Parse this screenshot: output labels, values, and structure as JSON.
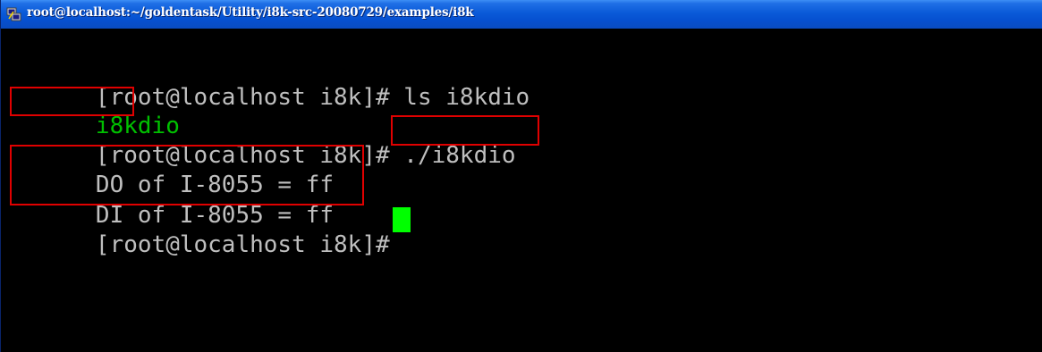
{
  "window": {
    "title": "root@localhost:~/goldentask/Utility/i8k-src-20080729/examples/i8k",
    "icon": "putty-terminal-icon"
  },
  "terminal": {
    "lines": [
      {
        "prompt": "[root@localhost i8k]# ",
        "text": "ls i8kdio"
      },
      {
        "text": "i8kdio"
      },
      {
        "prompt": "[root@localhost i8k]# ",
        "text": "./i8kdio"
      },
      {
        "text": "DO of I-8055 = ff"
      },
      {
        "text": "DI of I-8055 = ff"
      },
      {
        "prompt": "[root@localhost i8k]# ",
        "text": ""
      }
    ],
    "colors": {
      "foreground": "#bfbfbf",
      "background": "#000000",
      "executable": "#00c000",
      "cursor": "#00ff00",
      "highlight_border": "#e00000"
    }
  }
}
